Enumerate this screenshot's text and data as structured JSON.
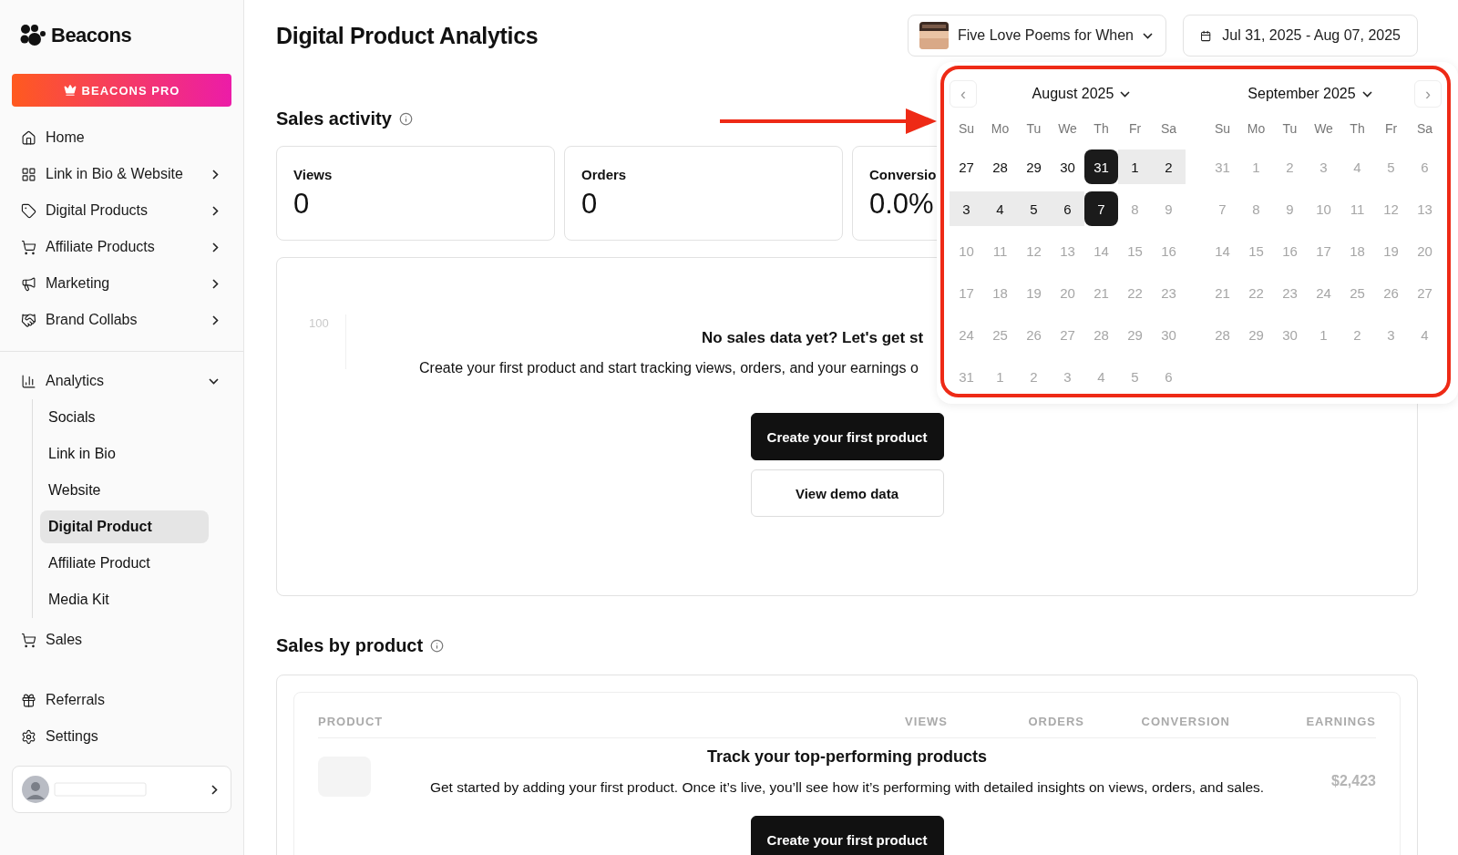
{
  "brand": {
    "name": "Beacons"
  },
  "pro_button": {
    "label": "BEACONS PRO"
  },
  "sidebar": {
    "home": {
      "label": "Home"
    },
    "items": [
      {
        "label": "Link in Bio & Website",
        "expanded": false
      },
      {
        "label": "Digital Products",
        "expanded": false
      },
      {
        "label": "Affiliate Products",
        "expanded": false
      },
      {
        "label": "Marketing",
        "expanded": false
      },
      {
        "label": "Brand Collabs",
        "expanded": false
      }
    ],
    "analytics": {
      "label": "Analytics",
      "expanded": true,
      "children": [
        {
          "label": "Socials",
          "selected": false
        },
        {
          "label": "Link in Bio",
          "selected": false
        },
        {
          "label": "Website",
          "selected": false
        },
        {
          "label": "Digital Product",
          "selected": true
        },
        {
          "label": "Affiliate Product",
          "selected": false
        },
        {
          "label": "Media Kit",
          "selected": false
        }
      ]
    },
    "sales": {
      "label": "Sales"
    },
    "footer": [
      {
        "label": "Referrals"
      },
      {
        "label": "Settings"
      }
    ]
  },
  "page": {
    "title": "Digital Product Analytics"
  },
  "product_select": {
    "value": "Five Love Poems for When"
  },
  "date_range": {
    "value": "Jul 31, 2025 - Aug 07, 2025"
  },
  "sales_activity": {
    "title": "Sales activity",
    "cards": [
      {
        "label": "Views",
        "value": "0"
      },
      {
        "label": "Orders",
        "value": "0"
      },
      {
        "label": "Conversio",
        "value": "0.0%"
      }
    ],
    "axis_label": "100",
    "empty_title": "No sales data yet? Let's get st",
    "empty_text": "Create your first product and start tracking views, orders, and your earnings o",
    "buttons": [
      {
        "label": "Create your first product",
        "kind": "primary"
      },
      {
        "label": "View demo data",
        "kind": "secondary"
      }
    ]
  },
  "sales_by_product": {
    "title": "Sales by product",
    "columns": [
      "PRODUCT",
      "VIEWS",
      "ORDERS",
      "CONVERSION",
      "EARNINGS"
    ],
    "ghost_value": "$2,423",
    "empty_title": "Track your top-performing products",
    "empty_text": "Get started by adding your first product. Once it’s live, you’ll see how it’s performing with detailed insights on views, orders, and sales.",
    "button": {
      "label": "Create your first product"
    }
  },
  "calendar": {
    "prev": "‹",
    "next": "›",
    "months": [
      {
        "title": "August 2025",
        "weekdays": [
          "Su",
          "Mo",
          "Tu",
          "We",
          "Th",
          "Fr",
          "Sa"
        ],
        "days": [
          {
            "label": "27",
            "selected": false,
            "in_range": false,
            "disabled": false
          },
          {
            "label": "28",
            "selected": false,
            "in_range": false,
            "disabled": false
          },
          {
            "label": "29",
            "selected": false,
            "in_range": false,
            "disabled": false
          },
          {
            "label": "30",
            "selected": false,
            "in_range": false,
            "disabled": false
          },
          {
            "label": "31",
            "selected": true,
            "in_range": false,
            "disabled": false
          },
          {
            "label": "1",
            "selected": false,
            "in_range": true,
            "disabled": false
          },
          {
            "label": "2",
            "selected": false,
            "in_range": true,
            "disabled": false
          },
          {
            "label": "3",
            "selected": false,
            "in_range": true,
            "disabled": false
          },
          {
            "label": "4",
            "selected": false,
            "in_range": true,
            "disabled": false
          },
          {
            "label": "5",
            "selected": false,
            "in_range": true,
            "disabled": false
          },
          {
            "label": "6",
            "selected": false,
            "in_range": true,
            "disabled": false
          },
          {
            "label": "7",
            "selected": true,
            "in_range": false,
            "disabled": false
          },
          {
            "label": "8",
            "selected": false,
            "in_range": false,
            "disabled": true
          },
          {
            "label": "9",
            "selected": false,
            "in_range": false,
            "disabled": true
          },
          {
            "label": "10",
            "selected": false,
            "in_range": false,
            "disabled": true
          },
          {
            "label": "11",
            "selected": false,
            "in_range": false,
            "disabled": true
          },
          {
            "label": "12",
            "selected": false,
            "in_range": false,
            "disabled": true
          },
          {
            "label": "13",
            "selected": false,
            "in_range": false,
            "disabled": true
          },
          {
            "label": "14",
            "selected": false,
            "in_range": false,
            "disabled": true
          },
          {
            "label": "15",
            "selected": false,
            "in_range": false,
            "disabled": true
          },
          {
            "label": "16",
            "selected": false,
            "in_range": false,
            "disabled": true
          },
          {
            "label": "17",
            "selected": false,
            "in_range": false,
            "disabled": true
          },
          {
            "label": "18",
            "selected": false,
            "in_range": false,
            "disabled": true
          },
          {
            "label": "19",
            "selected": false,
            "in_range": false,
            "disabled": true
          },
          {
            "label": "20",
            "selected": false,
            "in_range": false,
            "disabled": true
          },
          {
            "label": "21",
            "selected": false,
            "in_range": false,
            "disabled": true
          },
          {
            "label": "22",
            "selected": false,
            "in_range": false,
            "disabled": true
          },
          {
            "label": "23",
            "selected": false,
            "in_range": false,
            "disabled": true
          },
          {
            "label": "24",
            "selected": false,
            "in_range": false,
            "disabled": true
          },
          {
            "label": "25",
            "selected": false,
            "in_range": false,
            "disabled": true
          },
          {
            "label": "26",
            "selected": false,
            "in_range": false,
            "disabled": true
          },
          {
            "label": "27",
            "selected": false,
            "in_range": false,
            "disabled": true
          },
          {
            "label": "28",
            "selected": false,
            "in_range": false,
            "disabled": true
          },
          {
            "label": "29",
            "selected": false,
            "in_range": false,
            "disabled": true
          },
          {
            "label": "30",
            "selected": false,
            "in_range": false,
            "disabled": true
          },
          {
            "label": "31",
            "selected": false,
            "in_range": false,
            "disabled": true
          },
          {
            "label": "1",
            "selected": false,
            "in_range": false,
            "disabled": true
          },
          {
            "label": "2",
            "selected": false,
            "in_range": false,
            "disabled": true
          },
          {
            "label": "3",
            "selected": false,
            "in_range": false,
            "disabled": true
          },
          {
            "label": "4",
            "selected": false,
            "in_range": false,
            "disabled": true
          },
          {
            "label": "5",
            "selected": false,
            "in_range": false,
            "disabled": true
          },
          {
            "label": "6",
            "selected": false,
            "in_range": false,
            "disabled": true
          }
        ]
      },
      {
        "title": "September 2025",
        "weekdays": [
          "Su",
          "Mo",
          "Tu",
          "We",
          "Th",
          "Fr",
          "Sa"
        ],
        "days": [
          {
            "label": "31",
            "selected": false,
            "in_range": false,
            "disabled": true
          },
          {
            "label": "1",
            "selected": false,
            "in_range": false,
            "disabled": true
          },
          {
            "label": "2",
            "selected": false,
            "in_range": false,
            "disabled": true
          },
          {
            "label": "3",
            "selected": false,
            "in_range": false,
            "disabled": true
          },
          {
            "label": "4",
            "selected": false,
            "in_range": false,
            "disabled": true
          },
          {
            "label": "5",
            "selected": false,
            "in_range": false,
            "disabled": true
          },
          {
            "label": "6",
            "selected": false,
            "in_range": false,
            "disabled": true
          },
          {
            "label": "7",
            "selected": false,
            "in_range": false,
            "disabled": true
          },
          {
            "label": "8",
            "selected": false,
            "in_range": false,
            "disabled": true
          },
          {
            "label": "9",
            "selected": false,
            "in_range": false,
            "disabled": true
          },
          {
            "label": "10",
            "selected": false,
            "in_range": false,
            "disabled": true
          },
          {
            "label": "11",
            "selected": false,
            "in_range": false,
            "disabled": true
          },
          {
            "label": "12",
            "selected": false,
            "in_range": false,
            "disabled": true
          },
          {
            "label": "13",
            "selected": false,
            "in_range": false,
            "disabled": true
          },
          {
            "label": "14",
            "selected": false,
            "in_range": false,
            "disabled": true
          },
          {
            "label": "15",
            "selected": false,
            "in_range": false,
            "disabled": true
          },
          {
            "label": "16",
            "selected": false,
            "in_range": false,
            "disabled": true
          },
          {
            "label": "17",
            "selected": false,
            "in_range": false,
            "disabled": true
          },
          {
            "label": "18",
            "selected": false,
            "in_range": false,
            "disabled": true
          },
          {
            "label": "19",
            "selected": false,
            "in_range": false,
            "disabled": true
          },
          {
            "label": "20",
            "selected": false,
            "in_range": false,
            "disabled": true
          },
          {
            "label": "21",
            "selected": false,
            "in_range": false,
            "disabled": true
          },
          {
            "label": "22",
            "selected": false,
            "in_range": false,
            "disabled": true
          },
          {
            "label": "23",
            "selected": false,
            "in_range": false,
            "disabled": true
          },
          {
            "label": "24",
            "selected": false,
            "in_range": false,
            "disabled": true
          },
          {
            "label": "25",
            "selected": false,
            "in_range": false,
            "disabled": true
          },
          {
            "label": "26",
            "selected": false,
            "in_range": false,
            "disabled": true
          },
          {
            "label": "27",
            "selected": false,
            "in_range": false,
            "disabled": true
          },
          {
            "label": "28",
            "selected": false,
            "in_range": false,
            "disabled": true
          },
          {
            "label": "29",
            "selected": false,
            "in_range": false,
            "disabled": true
          },
          {
            "label": "30",
            "selected": false,
            "in_range": false,
            "disabled": true
          },
          {
            "label": "1",
            "selected": false,
            "in_range": false,
            "disabled": true
          },
          {
            "label": "2",
            "selected": false,
            "in_range": false,
            "disabled": true
          },
          {
            "label": "3",
            "selected": false,
            "in_range": false,
            "disabled": true
          },
          {
            "label": "4",
            "selected": false,
            "in_range": false,
            "disabled": true
          }
        ]
      }
    ]
  }
}
